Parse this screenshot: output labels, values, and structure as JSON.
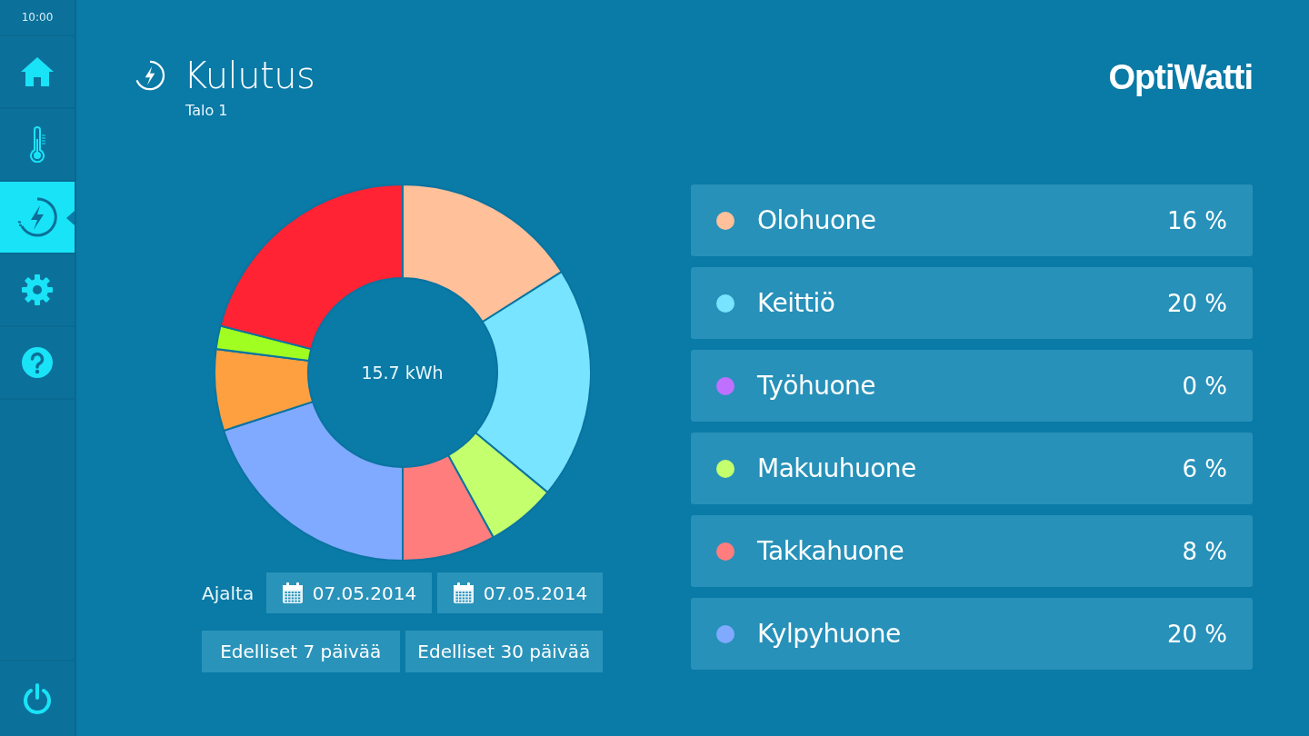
{
  "status": {
    "time": "10:00"
  },
  "sidebar": {
    "items": [
      {
        "kind": "home",
        "selected": false
      },
      {
        "kind": "temperature",
        "selected": false
      },
      {
        "kind": "energy",
        "selected": true
      },
      {
        "kind": "settings",
        "selected": false
      },
      {
        "kind": "help",
        "selected": false
      }
    ]
  },
  "header": {
    "title": "Kulutus",
    "subtitle": "Talo 1",
    "logo": "OptiWatti"
  },
  "chart": {
    "center_label": "15.7 kWh",
    "chart_data": {
      "type": "donut",
      "values": [
        16,
        20,
        6,
        8,
        20,
        7,
        2,
        21
      ],
      "colors": [
        "#ffc09a",
        "#78e4ff",
        "#c4ff6e",
        "#ff7d7d",
        "#80aaff",
        "#ffa040",
        "#a0ff20",
        "#ff2333"
      ]
    }
  },
  "period": {
    "label": "Ajalta",
    "start": "07.05.2014",
    "end": "07.05.2014",
    "presets": [
      "Edelliset 7 päivää",
      "Edelliset 30 päivää"
    ]
  },
  "rooms": [
    {
      "name": "Olohuone",
      "share": "16 %",
      "color": "#ffc09a"
    },
    {
      "name": "Keittiö",
      "share": "20 %",
      "color": "#78e4ff"
    },
    {
      "name": "Työhuone",
      "share": "0 %",
      "color": "#c070ff"
    },
    {
      "name": "Makuuhuone",
      "share": "6 %",
      "color": "#c4ff6e"
    },
    {
      "name": "Takkahuone",
      "share": "8 %",
      "color": "#ff7d7d"
    },
    {
      "name": "Kylpyhuone",
      "share": "20 %",
      "color": "#80aaff"
    }
  ]
}
